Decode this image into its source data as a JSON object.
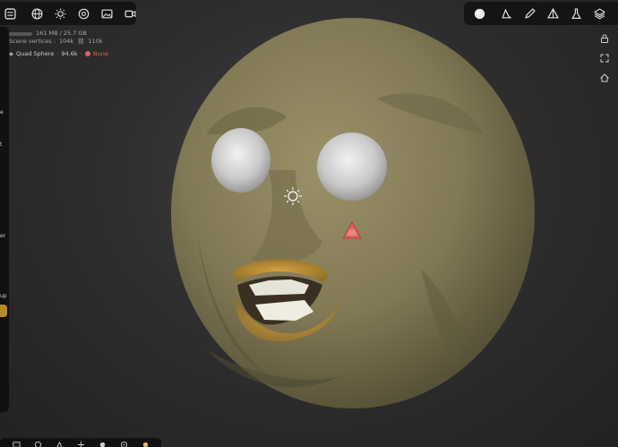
{
  "app": {
    "accent_color": "#e9b74a",
    "warning_color": "#e0605a"
  },
  "toolbar_left": {
    "icons": [
      "menu-icon",
      "globe-icon",
      "sun-icon",
      "settings-icon",
      "image-icon",
      "camera-icon"
    ]
  },
  "toolbar_right": {
    "icons": [
      "brush-sphere-icon",
      "tool-icon",
      "pen-icon",
      "material-icon",
      "flask-icon",
      "layers-icon",
      "more-icon"
    ]
  },
  "stats": {
    "memory": "161 MB / 25.7 GB",
    "scene_vertices_label": "Scene vertices :",
    "scene_vertices_value": "104k",
    "scene_link_value": "110k"
  },
  "mesh": {
    "name": "Quad Sphere",
    "separator": "·",
    "count": "94.6k",
    "status": "Nune"
  },
  "left_panel_labels": [
    "e",
    "t",
    "er",
    "up"
  ]
}
